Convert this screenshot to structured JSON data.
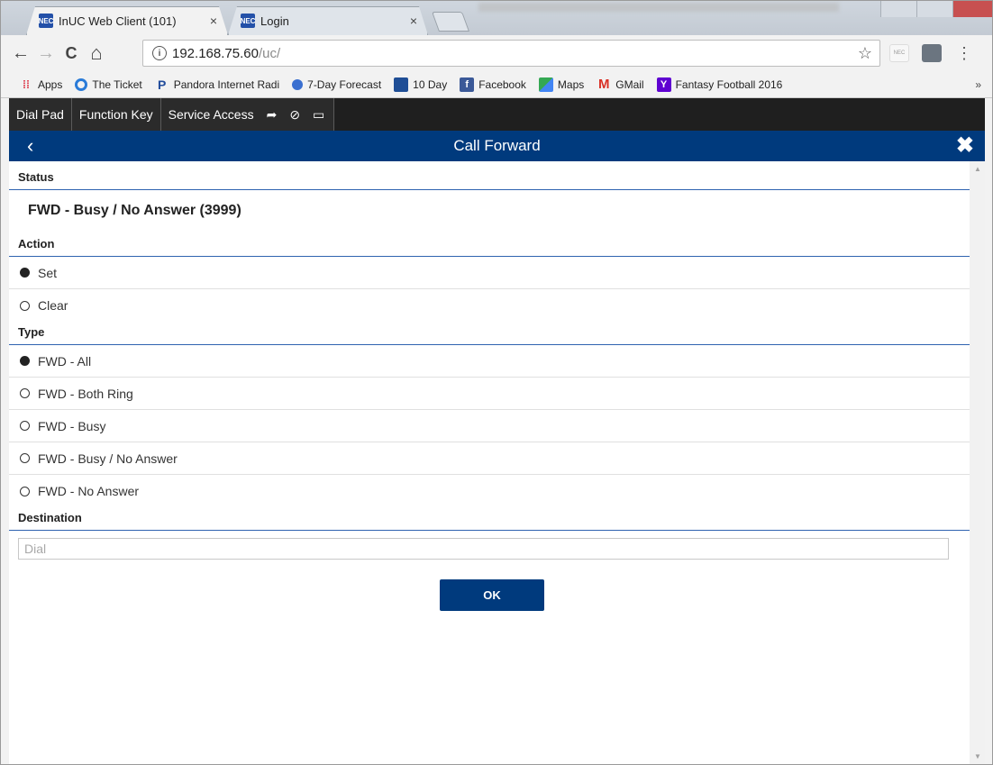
{
  "browser": {
    "tabs": [
      {
        "title": "InUC Web Client (101)",
        "favicon": "NEC",
        "close": "×"
      },
      {
        "title": "Login",
        "favicon": "NEC",
        "close": "×"
      }
    ],
    "nav": {
      "back": "←",
      "forward": "→",
      "reload": "C",
      "home": "⌂"
    },
    "url": {
      "info_icon": "i",
      "host": "192.168.75.60",
      "path": "/uc/"
    },
    "star": "☆",
    "ext_nec": "NEC",
    "menu": "⋮",
    "bookmarks": [
      {
        "label": "Apps",
        "icon": "apps-grid-icon"
      },
      {
        "label": "The Ticket",
        "icon": "ticket-icon"
      },
      {
        "label": "Pandora Internet Radi",
        "icon": "pandora-icon"
      },
      {
        "label": "7-Day Forecast",
        "icon": "weather-icon"
      },
      {
        "label": "10 Day",
        "icon": "weather-channel-icon"
      },
      {
        "label": "Facebook",
        "icon": "facebook-icon"
      },
      {
        "label": "Maps",
        "icon": "maps-icon"
      },
      {
        "label": "GMail",
        "icon": "gmail-icon"
      },
      {
        "label": "Fantasy Football 2016",
        "icon": "yahoo-icon"
      }
    ],
    "bookmarks_more": "»"
  },
  "app": {
    "nav": {
      "dial_pad": "Dial Pad",
      "function_key": "Function Key",
      "service_access": "Service Access",
      "forward_icon": "➦",
      "dnd_icon": "⊘",
      "computer_icon": "▭"
    },
    "header": {
      "back": "‹",
      "title": "Call Forward",
      "close": "✖"
    },
    "status": {
      "label": "Status",
      "value": "FWD - Busy / No Answer (3999)"
    },
    "action": {
      "label": "Action",
      "options": [
        {
          "label": "Set",
          "selected": true
        },
        {
          "label": "Clear",
          "selected": false
        }
      ]
    },
    "type": {
      "label": "Type",
      "options": [
        {
          "label": "FWD - All",
          "selected": true
        },
        {
          "label": "FWD - Both Ring",
          "selected": false
        },
        {
          "label": "FWD - Busy",
          "selected": false
        },
        {
          "label": "FWD - Busy / No Answer",
          "selected": false
        },
        {
          "label": "FWD - No Answer",
          "selected": false
        }
      ]
    },
    "destination": {
      "label": "Destination",
      "placeholder": "Dial",
      "value": ""
    },
    "ok_label": "OK"
  },
  "colors": {
    "header_blue": "#003a7d",
    "nav_dark": "#2b2b2b",
    "rule_blue": "#2f63b0"
  }
}
